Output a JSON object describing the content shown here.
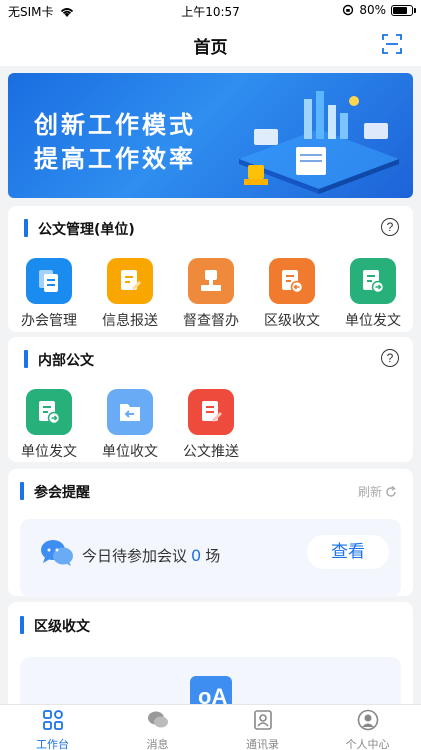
{
  "status": {
    "carrier": "无SIM卡",
    "time": "上午10:57",
    "battery": "80%",
    "battery_level": 0.8
  },
  "nav": {
    "title": "首页"
  },
  "banner": {
    "line1": "创新工作模式",
    "line2": "提高工作效率"
  },
  "docs_mgmt": {
    "title": "公文管理(单位)",
    "help": "?",
    "items": [
      {
        "label": "办会管理",
        "color": "#1a8cf0",
        "icon": "copy-icon"
      },
      {
        "label": "信息报送",
        "color": "#f9a600",
        "icon": "doc-edit-icon"
      },
      {
        "label": "督查督办",
        "color": "#ef8a3c",
        "icon": "stamp-icon"
      },
      {
        "label": "区级收文",
        "color": "#f07a2e",
        "icon": "doc-receive-icon"
      },
      {
        "label": "单位发文",
        "color": "#27b07a",
        "icon": "doc-send-icon"
      }
    ]
  },
  "internal_docs": {
    "title": "内部公文",
    "help": "?",
    "items": [
      {
        "label": "单位发文",
        "color": "#27b07a",
        "icon": "doc-send-icon"
      },
      {
        "label": "单位收文",
        "color": "#6aabf5",
        "icon": "folder-in-icon"
      },
      {
        "label": "公文推送",
        "color": "#ee4b3c",
        "icon": "doc-push-icon"
      }
    ]
  },
  "meeting": {
    "title": "参会提醒",
    "refresh": "刷新",
    "text_before": "今日待参加会议",
    "count": "0",
    "text_after": "场",
    "view_button": "查看"
  },
  "district": {
    "title": "区级收文"
  },
  "tabs": [
    {
      "label": "工作台",
      "icon": "grid-icon",
      "active": true
    },
    {
      "label": "消息",
      "icon": "chat-icon",
      "active": false
    },
    {
      "label": "通讯录",
      "icon": "contacts-icon",
      "active": false
    },
    {
      "label": "个人中心",
      "icon": "user-icon",
      "active": false
    }
  ],
  "colors": {
    "accent": "#1a73e8",
    "background": "#f2f3f5"
  }
}
